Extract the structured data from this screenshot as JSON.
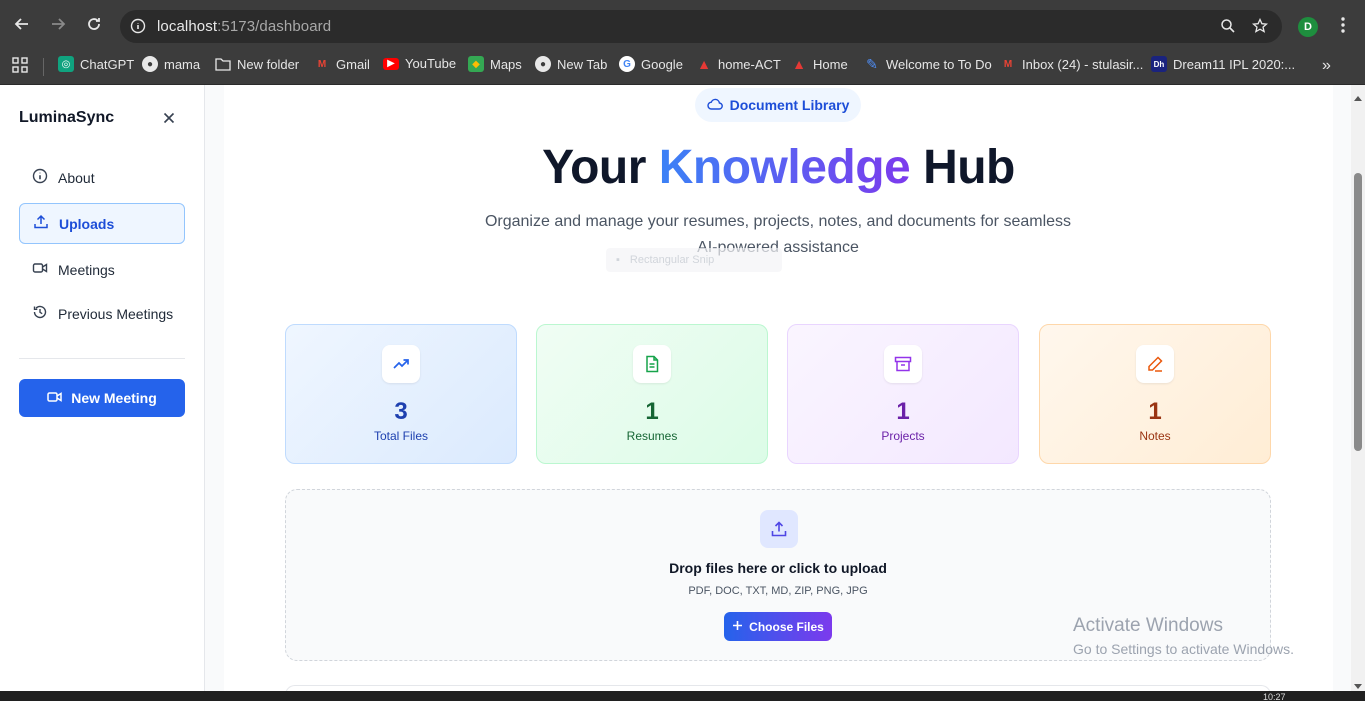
{
  "browser": {
    "url_host": "localhost",
    "url_path": ":5173/dashboard",
    "profile_initial": "D",
    "bookmarks": [
      {
        "label": "ChatGPT",
        "icon": "chatgpt-icon"
      },
      {
        "label": "mama",
        "icon": "globe-icon"
      },
      {
        "label": "New folder",
        "icon": "folder-icon"
      },
      {
        "label": "Gmail",
        "icon": "gmail-icon"
      },
      {
        "label": "YouTube",
        "icon": "youtube-icon"
      },
      {
        "label": "Maps",
        "icon": "maps-icon"
      },
      {
        "label": "New Tab",
        "icon": "globe-icon"
      },
      {
        "label": "Google",
        "icon": "google-icon"
      },
      {
        "label": "home-ACT",
        "icon": "act-icon"
      },
      {
        "label": "Home",
        "icon": "act-icon"
      },
      {
        "label": "Welcome to To Do",
        "icon": "todo-icon"
      },
      {
        "label": "Inbox (24) - stulasir...",
        "icon": "gmail-icon"
      },
      {
        "label": "Dream11 IPL 2020:...",
        "icon": "dream11-icon"
      }
    ]
  },
  "sidebar": {
    "brand": "LuminaSync",
    "items": [
      {
        "label": "About",
        "icon": "info-icon",
        "active": false
      },
      {
        "label": "Uploads",
        "icon": "upload-icon",
        "active": true
      },
      {
        "label": "Meetings",
        "icon": "video-icon",
        "active": false
      },
      {
        "label": "Previous Meetings",
        "icon": "history-icon",
        "active": false
      }
    ],
    "new_meeting_label": "New Meeting"
  },
  "main": {
    "pill_label": "Document Library",
    "title_start": "Your ",
    "title_highlight": "Knowledge",
    "title_end": " Hub",
    "subtitle": "Organize and manage your resumes, projects, notes, and documents for seamless AI-powered assistance",
    "ghost_chip": "Rectangular Snip",
    "stats": [
      {
        "value": "3",
        "label": "Total Files",
        "icon": "trending-up-icon",
        "color": "#1e40af"
      },
      {
        "value": "1",
        "label": "Resumes",
        "icon": "file-text-icon",
        "color": "#166534"
      },
      {
        "value": "1",
        "label": "Projects",
        "icon": "archive-icon",
        "color": "#6b21a8"
      },
      {
        "value": "1",
        "label": "Notes",
        "icon": "pen-icon",
        "color": "#9a3412"
      }
    ],
    "upload": {
      "title": "Drop files here or click to upload",
      "types": "PDF, DOC, TXT, MD, ZIP, PNG, JPG",
      "button": "Choose Files"
    }
  },
  "watermark": {
    "line1": "Activate Windows",
    "line2": "Go to Settings to activate Windows."
  },
  "taskbar": {
    "clock": "10:27"
  },
  "colors": {
    "primary": "#2563eb",
    "accent": "#7c3aed",
    "chrome": "#3c3c3c"
  }
}
